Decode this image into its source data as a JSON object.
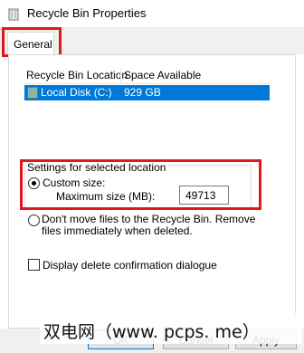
{
  "window": {
    "title": "Recycle Bin Properties",
    "icon": "recycle-bin-icon"
  },
  "tabs": [
    {
      "label": "General",
      "selected": true
    }
  ],
  "list": {
    "columns": [
      "Recycle Bin Location",
      "Space Available"
    ],
    "rows": [
      {
        "location": "Local Disk (C:)",
        "space": "929 GB",
        "icon": "drive-icon",
        "selected": true
      }
    ]
  },
  "settings": {
    "group_title": "Settings for selected location",
    "custom_size_label": "Custom size:",
    "max_size_label": "Maximum size (MB):",
    "max_size_value": "49713",
    "dont_move_label": "Don't move files to the Recycle Bin. Remove files immediately when deleted.",
    "selected_option": "custom"
  },
  "confirm_checkbox": {
    "label": "Display delete confirmation dialogue",
    "checked": false
  },
  "buttons": {
    "ok": "OK",
    "cancel": "Cancel",
    "apply": "Apply"
  },
  "watermark": "双电网（www. pcps. me）",
  "colors": {
    "selection": "#0078d7",
    "annotation": "#e0171b"
  }
}
